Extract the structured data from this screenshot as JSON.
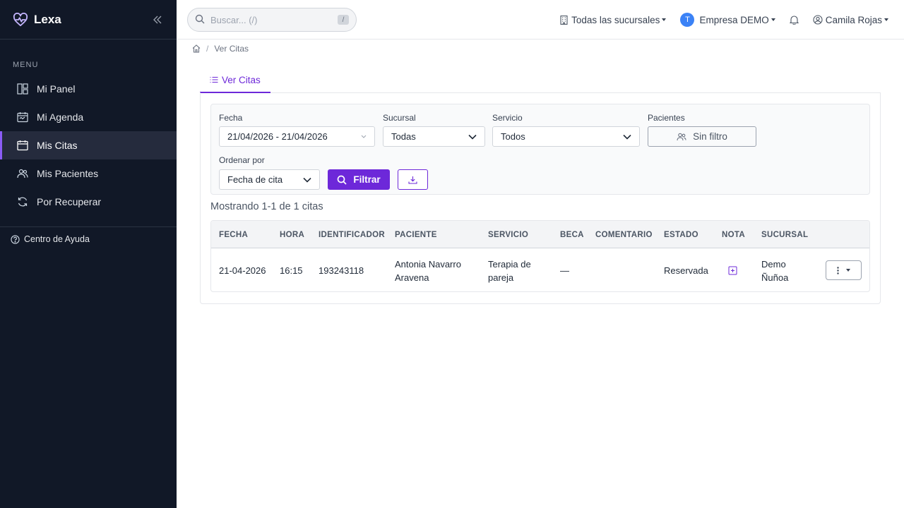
{
  "app": {
    "name": "Lexa"
  },
  "sidebar": {
    "menu_title": "MENU",
    "items": [
      {
        "label": "Mi Panel",
        "icon": "dashboard-icon",
        "active": false
      },
      {
        "label": "Mi Agenda",
        "icon": "calendar-icon",
        "active": false
      },
      {
        "label": "Mis Citas",
        "icon": "calendar-blank-icon",
        "active": true
      },
      {
        "label": "Mis Pacientes",
        "icon": "users-icon",
        "active": false
      },
      {
        "label": "Por Recuperar",
        "icon": "refresh-icon",
        "active": false
      }
    ],
    "help_label": "Centro de Ayuda"
  },
  "topbar": {
    "search_placeholder": "Buscar... (/)",
    "search_shortcut": "/",
    "branches_label": "Todas las sucursales",
    "company_initial": "T",
    "company_label": "Empresa DEMO",
    "user_label": "Camila Rojas"
  },
  "breadcrumb": {
    "current": "Ver Citas"
  },
  "tabs": [
    {
      "label": "Ver Citas",
      "active": true
    }
  ],
  "filters": {
    "date_label": "Fecha",
    "date_value": "21/04/2026 - 21/04/2026",
    "branch_label": "Sucursal",
    "branch_value": "Todas",
    "service_label": "Servicio",
    "service_value": "Todos",
    "patients_label": "Pacientes",
    "patients_button": "Sin filtro",
    "sort_label": "Ordenar por",
    "sort_value": "Fecha de cita",
    "filter_button": "Filtrar"
  },
  "results": {
    "summary": "Mostrando 1-1 de 1 citas"
  },
  "table": {
    "headers": [
      "FECHA",
      "HORA",
      "IDENTIFICADOR",
      "PACIENTE",
      "SERVICIO",
      "BECA",
      "COMENTARIO",
      "ESTADO",
      "NOTA",
      "SUCURSAL"
    ],
    "rows": [
      {
        "fecha": "21-04-2026",
        "hora": "16:15",
        "identificador": "193243118",
        "paciente": "Antonia Navarro Aravena",
        "servicio": "Terapia de pareja",
        "beca": "—",
        "comentario": "",
        "estado": "Reservada",
        "sucursal": "Demo Ñuñoa"
      }
    ]
  },
  "colors": {
    "sidebar_bg": "#111827",
    "accent": "#6d28d9",
    "active_marker": "#8b5cf6"
  }
}
